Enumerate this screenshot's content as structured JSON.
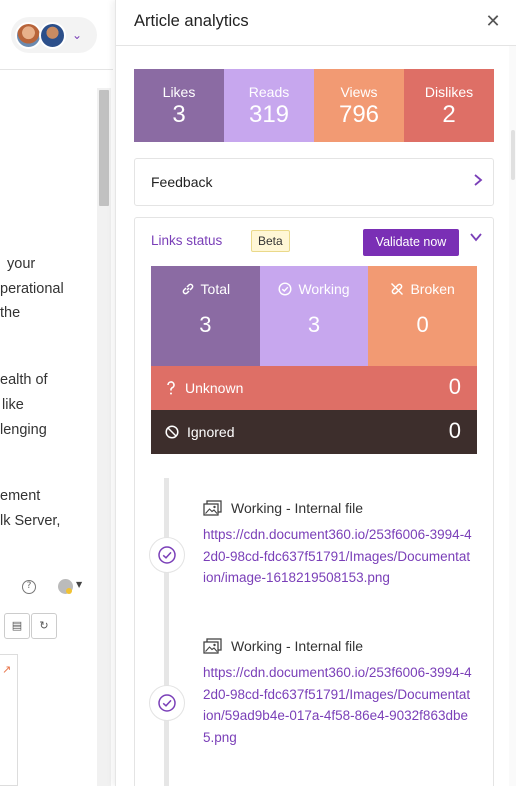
{
  "left_pane": {
    "text_block_1": [
      "your",
      "perational",
      "the"
    ],
    "text_block_2": [
      "ealth of",
      "like",
      "lenging"
    ],
    "text_block_3": [
      "ement",
      "lk Server,"
    ]
  },
  "drawer": {
    "title": "Article analytics",
    "close_icon": "close-icon",
    "stats": [
      {
        "label": "Likes",
        "value": "3",
        "color": "#8b6ba3"
      },
      {
        "label": "Reads",
        "value": "319",
        "color": "#c7a7ee"
      },
      {
        "label": "Views",
        "value": "796",
        "color": "#f29a73"
      },
      {
        "label": "Dislikes",
        "value": "2",
        "color": "#de6f66"
      }
    ],
    "feedback": {
      "label": "Feedback"
    },
    "links_status": {
      "title": "Links status",
      "badge": "Beta",
      "validate_button": "Validate now",
      "cells": {
        "total": {
          "label": "Total",
          "value": "3",
          "color": "#8b6ba3",
          "icon": "link-icon"
        },
        "working": {
          "label": "Working",
          "value": "3",
          "color": "#c7a7ee",
          "icon": "check-circle-icon"
        },
        "broken": {
          "label": "Broken",
          "value": "0",
          "color": "#f29a73",
          "icon": "broken-link-icon"
        },
        "unknown": {
          "label": "Unknown",
          "value": "0",
          "color": "#de6f66",
          "icon": "question-icon"
        },
        "ignored": {
          "label": "Ignored",
          "value": "0",
          "color": "#3d2e2c",
          "icon": "ban-icon"
        }
      },
      "timeline": [
        {
          "status": "Working - Internal file",
          "url": "https://cdn.document360.io/253f6006-3994-42d0-98cd-fdc637f51791/Images/Documentation/image-1618219508153.png",
          "icon": "image-icon"
        },
        {
          "status": "Working - Internal file",
          "url": "https://cdn.document360.io/253f6006-3994-42d0-98cd-fdc637f51791/Images/Documentation/59ad9b4e-017a-4f58-86e4-9032f863dbe5.png",
          "icon": "image-icon"
        }
      ]
    }
  }
}
